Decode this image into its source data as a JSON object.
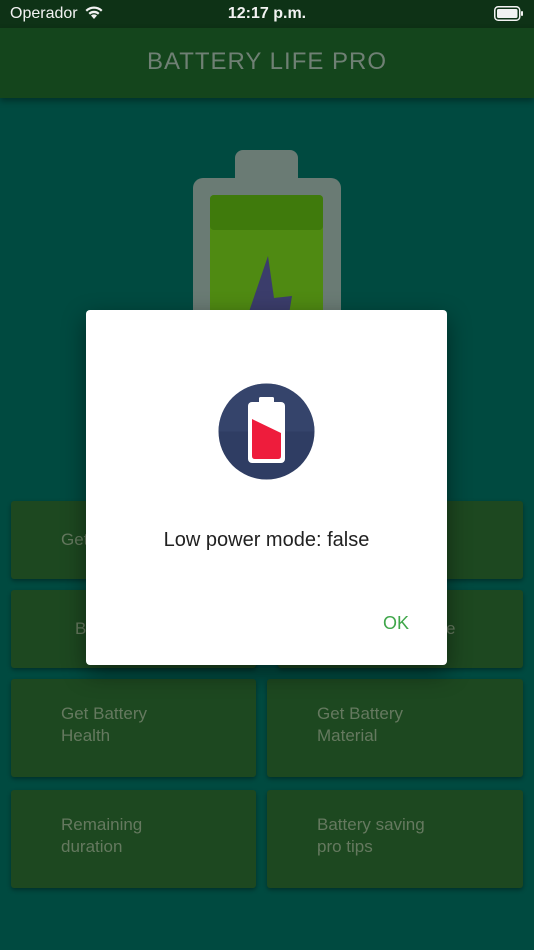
{
  "status_bar": {
    "carrier": "Operador",
    "time": "12:17 p.m."
  },
  "app_bar": {
    "title": "BATTERY LIFE PRO"
  },
  "grid": {
    "items": [
      {
        "label": "Get"
      },
      {
        "label": ""
      },
      {
        "label": "B"
      },
      {
        "label": "e"
      },
      {
        "label": "Get Battery\nHealth"
      },
      {
        "label": "Get Battery\nMaterial"
      },
      {
        "label": "Remaining\nduration"
      },
      {
        "label": "Battery saving\npro tips"
      }
    ]
  },
  "dialog": {
    "message": "Low power mode: false",
    "ok_label": "OK",
    "icon": "battery-low-icon"
  },
  "colors": {
    "background": "#004a40",
    "app_bar": "#14451c",
    "tile": "#1d4820",
    "ok_text": "#3fa64a",
    "battery_fill_red": "#ee1c3c",
    "icon_circle": "#2f3d63"
  }
}
